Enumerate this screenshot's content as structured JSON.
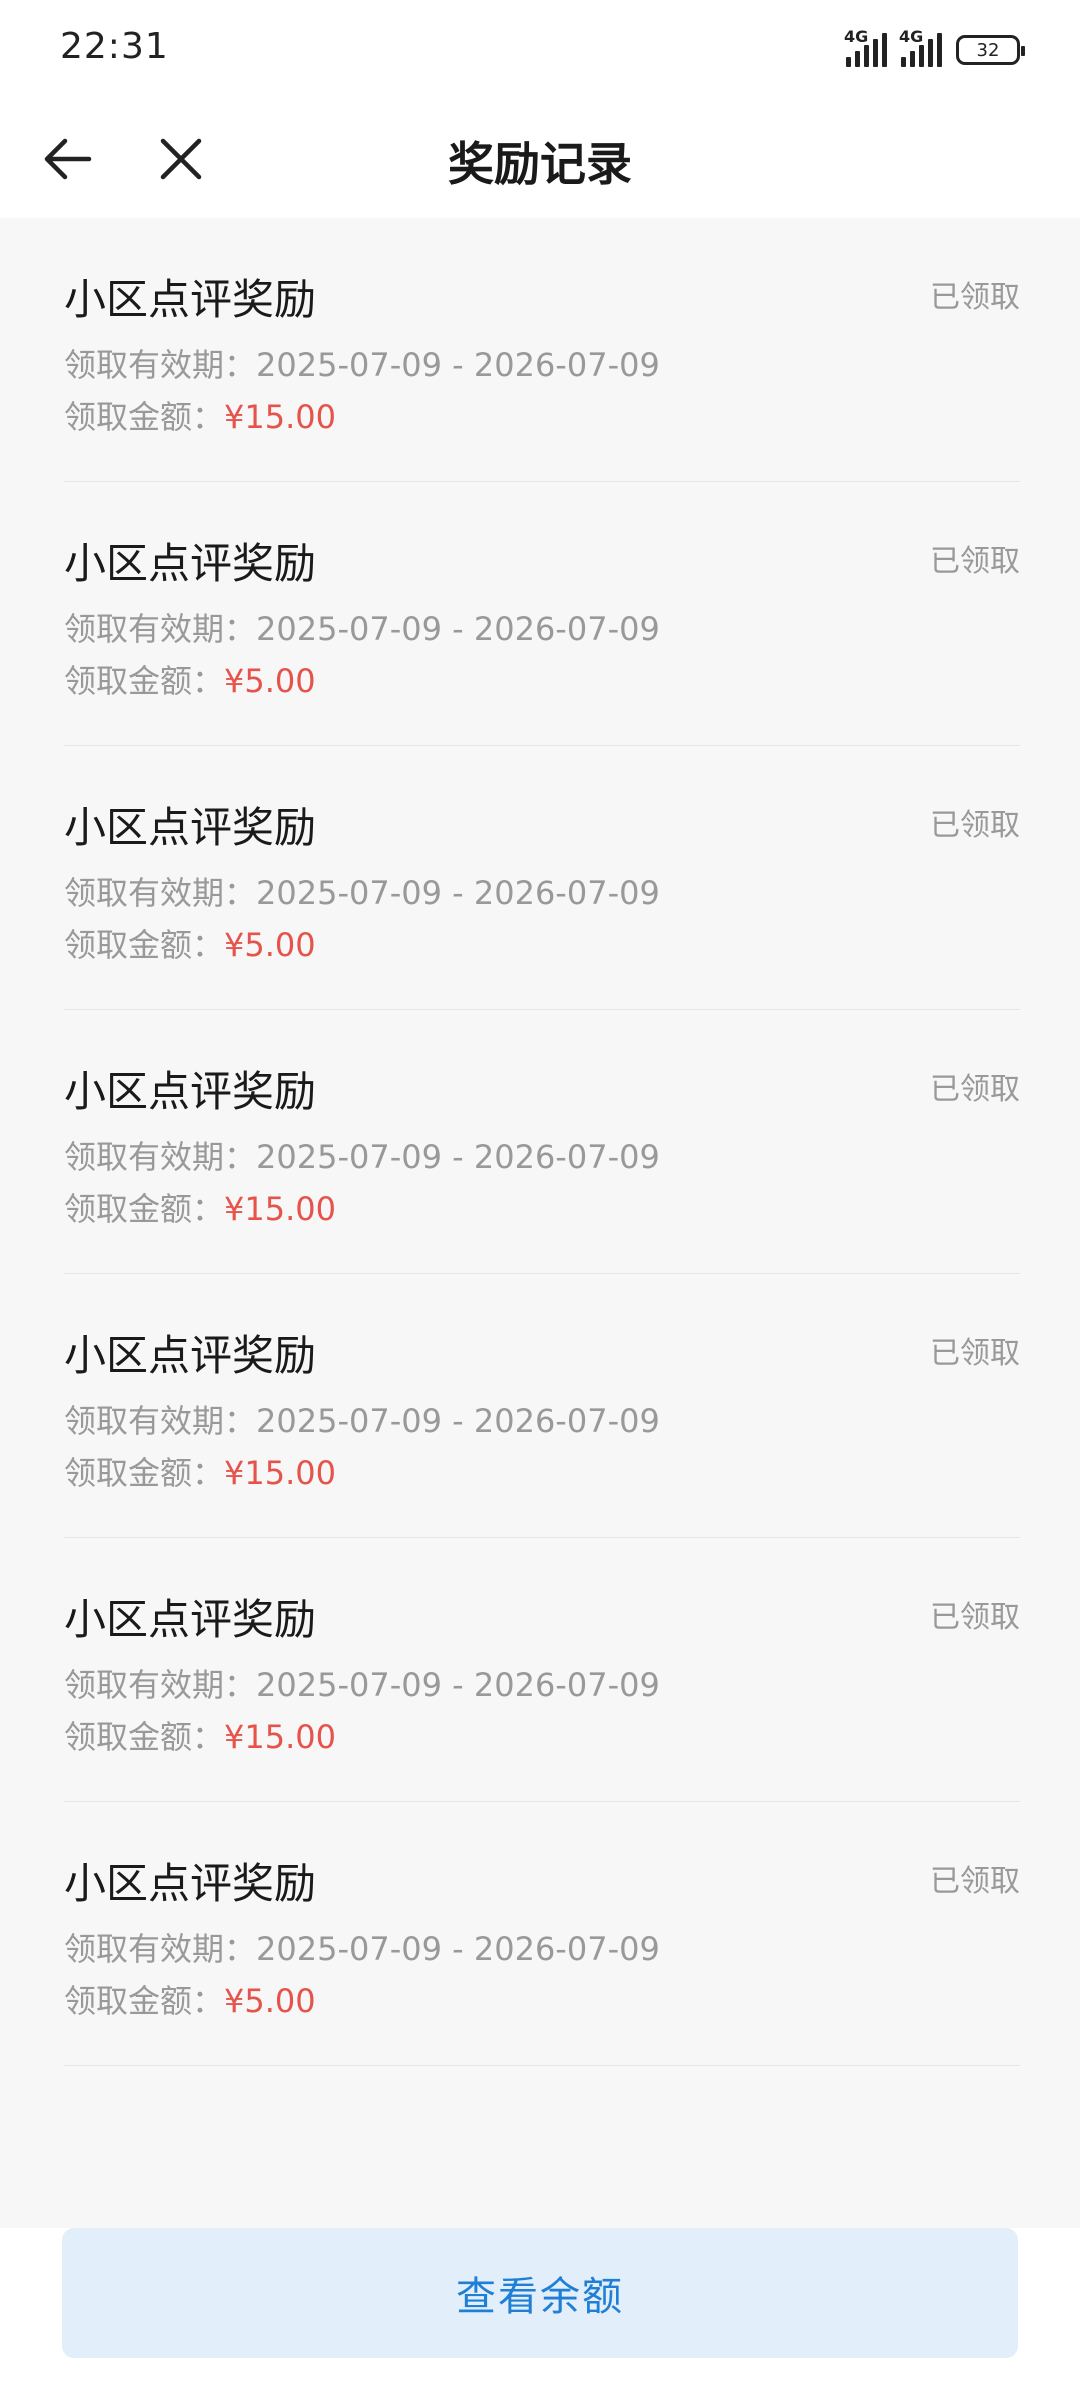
{
  "status_bar": {
    "time": "22:31",
    "network_1": "4G",
    "network_2": "4G",
    "battery": "32",
    "icons": [
      "signal-icon",
      "signal-icon",
      "battery-icon"
    ]
  },
  "nav": {
    "back_icon": "arrow-left-icon",
    "close_icon": "close-icon",
    "title": "奖励记录"
  },
  "records": [
    {
      "title": "小区点评奖励",
      "status": "已领取",
      "validity": "领取有效期：2025-07-09 - 2026-07-09",
      "amount_label": "领取金额：",
      "amount": "¥15.00"
    },
    {
      "title": "小区点评奖励",
      "status": "已领取",
      "validity": "领取有效期：2025-07-09 - 2026-07-09",
      "amount_label": "领取金额：",
      "amount": "¥5.00"
    },
    {
      "title": "小区点评奖励",
      "status": "已领取",
      "validity": "领取有效期：2025-07-09 - 2026-07-09",
      "amount_label": "领取金额：",
      "amount": "¥5.00"
    },
    {
      "title": "小区点评奖励",
      "status": "已领取",
      "validity": "领取有效期：2025-07-09 - 2026-07-09",
      "amount_label": "领取金额：",
      "amount": "¥15.00"
    },
    {
      "title": "小区点评奖励",
      "status": "已领取",
      "validity": "领取有效期：2025-07-09 - 2026-07-09",
      "amount_label": "领取金额：",
      "amount": "¥15.00"
    },
    {
      "title": "小区点评奖励",
      "status": "已领取",
      "validity": "领取有效期：2025-07-09 - 2026-07-09",
      "amount_label": "领取金额：",
      "amount": "¥15.00"
    },
    {
      "title": "小区点评奖励",
      "status": "已领取",
      "validity": "领取有效期：2025-07-09 - 2026-07-09",
      "amount_label": "领取金额：",
      "amount": "¥5.00"
    }
  ],
  "bottom": {
    "button_label": "查看余额"
  },
  "colors": {
    "amount": "#e5534b",
    "button_bg": "#e2effa",
    "button_text": "#1f7fd6",
    "list_bg": "#f7f7f7"
  }
}
